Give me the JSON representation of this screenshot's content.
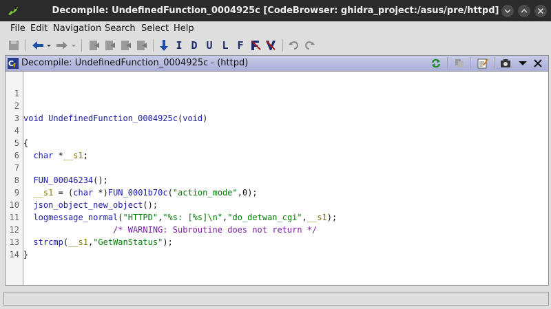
{
  "window": {
    "title": "Decompile: UndefinedFunction_0004925c [CodeBrowser: ghidra_project:/asus/pre/httpd]"
  },
  "menu": {
    "items": [
      {
        "label": "File"
      },
      {
        "label": "Edit"
      },
      {
        "label": "Navigation"
      },
      {
        "label": "Search"
      },
      {
        "label": "Select"
      },
      {
        "label": "Help"
      }
    ]
  },
  "toolbar": {
    "letter_buttons": [
      "I",
      "D",
      "U",
      "L",
      "F"
    ]
  },
  "panel": {
    "title": "Decompile: UndefinedFunction_0004925c -  (httpd)"
  },
  "code": {
    "line_numbers": [
      "1",
      "2",
      "3",
      "4",
      "5",
      "6",
      "7",
      "8",
      "9",
      "10",
      "11",
      "12",
      "13",
      "14"
    ],
    "l2": {
      "kw": "void",
      "fn": "UndefinedFunction_0004925c",
      "open": "(",
      "kw2": "void",
      "close": ")"
    },
    "l4": "{",
    "l5": {
      "kw": "char",
      "star": " *",
      "var": "__s1",
      "end": ";"
    },
    "l7": {
      "fn": "FUN_00046234",
      "end": "();"
    },
    "l8": {
      "var": "__s1",
      "eq": " = (",
      "kw": "char",
      "cast": " *)",
      "fn": "FUN_0001b70c",
      "open": "(",
      "str": "\"action_mode\"",
      "comma": ",",
      "num": "0",
      "end": ");"
    },
    "l9": {
      "fn": "json_object_new_object",
      "end": "();"
    },
    "l10": {
      "fn": "logmessage_normal",
      "open": "(",
      "s1": "\"HTTPD\"",
      "c1": ",",
      "s2": "\"%s: [%s]\\n\"",
      "c2": ",",
      "s3": "\"do_detwan_cgi\"",
      "c3": ",",
      "var": "__s1",
      "end": ");"
    },
    "l11": "/* WARNING: Subroutine does not return */",
    "l12": {
      "fn": "strcmp",
      "open": "(",
      "var": "__s1",
      "comma": ",",
      "str": "\"GetWanStatus\"",
      "end": ");"
    },
    "l13": "}"
  }
}
